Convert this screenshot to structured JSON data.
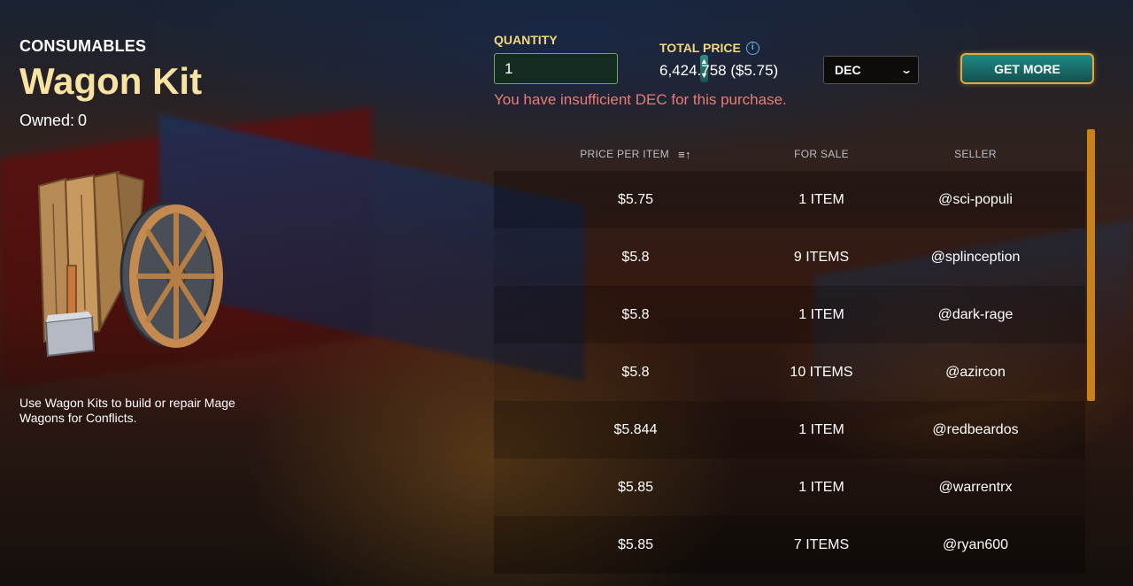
{
  "item": {
    "category": "CONSUMABLES",
    "name": "Wagon Kit",
    "owned_label": "Owned:",
    "owned_count": "0",
    "description": "Use Wagon Kits to build or repair Mage Wagons for Conflicts."
  },
  "purchase": {
    "quantity_label": "QUANTITY",
    "quantity_value": "1",
    "total_price_label": "TOTAL PRICE",
    "total_price_value": "6,424.758 ($5.75)",
    "currency_selected": "DEC",
    "get_more_label": "GET MORE",
    "warning": "You have insufficient DEC for this purchase."
  },
  "listings": {
    "columns": {
      "price": "PRICE PER ITEM",
      "for_sale": "FOR SALE",
      "seller": "SELLER"
    },
    "rows": [
      {
        "price": "$5.75",
        "for_sale": "1 ITEM",
        "seller": "@sci-populi"
      },
      {
        "price": "$5.8",
        "for_sale": "9 ITEMS",
        "seller": "@splinception"
      },
      {
        "price": "$5.8",
        "for_sale": "1 ITEM",
        "seller": "@dark-rage"
      },
      {
        "price": "$5.8",
        "for_sale": "10 ITEMS",
        "seller": "@azircon"
      },
      {
        "price": "$5.844",
        "for_sale": "1 ITEM",
        "seller": "@redbeardos"
      },
      {
        "price": "$5.85",
        "for_sale": "1 ITEM",
        "seller": "@warrentrx"
      },
      {
        "price": "$5.85",
        "for_sale": "7 ITEMS",
        "seller": "@ryan600"
      }
    ]
  },
  "icons": {
    "info": "info-icon",
    "sort": "sort-ascending-icon",
    "chevron": "chevron-down-icon",
    "stepper_up": "caret-up-icon",
    "stepper_down": "caret-down-icon"
  },
  "colors": {
    "title_gold": "#f9e3a2",
    "label_gold": "#f4d77a",
    "warning_red": "#ea7b78",
    "button_teal": "#1f8a86",
    "button_border": "#e8a63a",
    "scrollbar": "#c88219"
  }
}
